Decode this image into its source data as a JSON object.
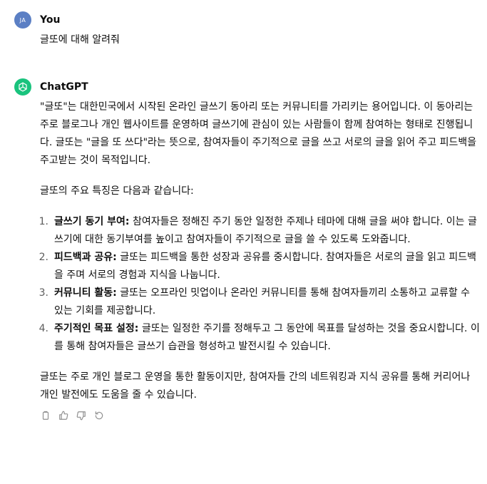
{
  "user_message": {
    "avatar_initials": "JA",
    "author": "You",
    "text": "글또에 대해 알려줘"
  },
  "assistant_message": {
    "author": "ChatGPT",
    "intro": "\"글또\"는 대한민국에서 시작된 온라인 글쓰기 동아리 또는 커뮤니티를 가리키는 용어입니다. 이 동아리는 주로 블로그나 개인 웹사이트를 운영하며 글쓰기에 관심이 있는 사람들이 함께 참여하는 형태로 진행됩니다. 글또는 \"글을 또 쓰다\"라는 뜻으로, 참여자들이 주기적으로 글을 쓰고 서로의 글을 읽어 주고 피드백을 주고받는 것이 목적입니다.",
    "features_heading": "글또의 주요 특징은 다음과 같습니다:",
    "features": [
      {
        "num": "1.",
        "title": "글쓰기 동기 부여:",
        "text": " 참여자들은 정해진 주기 동안 일정한 주제나 테마에 대해 글을 써야 합니다. 이는 글쓰기에 대한 동기부여를 높이고 참여자들이 주기적으로 글을 쓸 수 있도록 도와줍니다."
      },
      {
        "num": "2.",
        "title": "피드백과 공유:",
        "text": " 글또는 피드백을 통한 성장과 공유를 중시합니다. 참여자들은 서로의 글을 읽고 피드백을 주며 서로의 경험과 지식을 나눕니다."
      },
      {
        "num": "3.",
        "title": "커뮤니티 활동:",
        "text": " 글또는 오프라인 밋업이나 온라인 커뮤니티를 통해 참여자들끼리 소통하고 교류할 수 있는 기회를 제공합니다."
      },
      {
        "num": "4.",
        "title": "주기적인 목표 설정:",
        "text": " 글또는 일정한 주기를 정해두고 그 동안에 목표를 달성하는 것을 중요시합니다. 이를 통해 참여자들은 글쓰기 습관을 형성하고 발전시킬 수 있습니다."
      }
    ],
    "conclusion": "글또는 주로 개인 블로그 운영을 통한 활동이지만, 참여자들 간의 네트워킹과 지식 공유를 통해 커리어나 개인 발전에도 도움을 줄 수 있습니다.",
    "actions": [
      "copy-icon",
      "thumbs-up-icon",
      "thumbs-down-icon",
      "regenerate-icon"
    ]
  },
  "colors": {
    "user_avatar": "#5b7fc4",
    "assistant_avatar": "#19c37d",
    "text": "#0d0d0d",
    "icon": "#8e8e8e"
  }
}
